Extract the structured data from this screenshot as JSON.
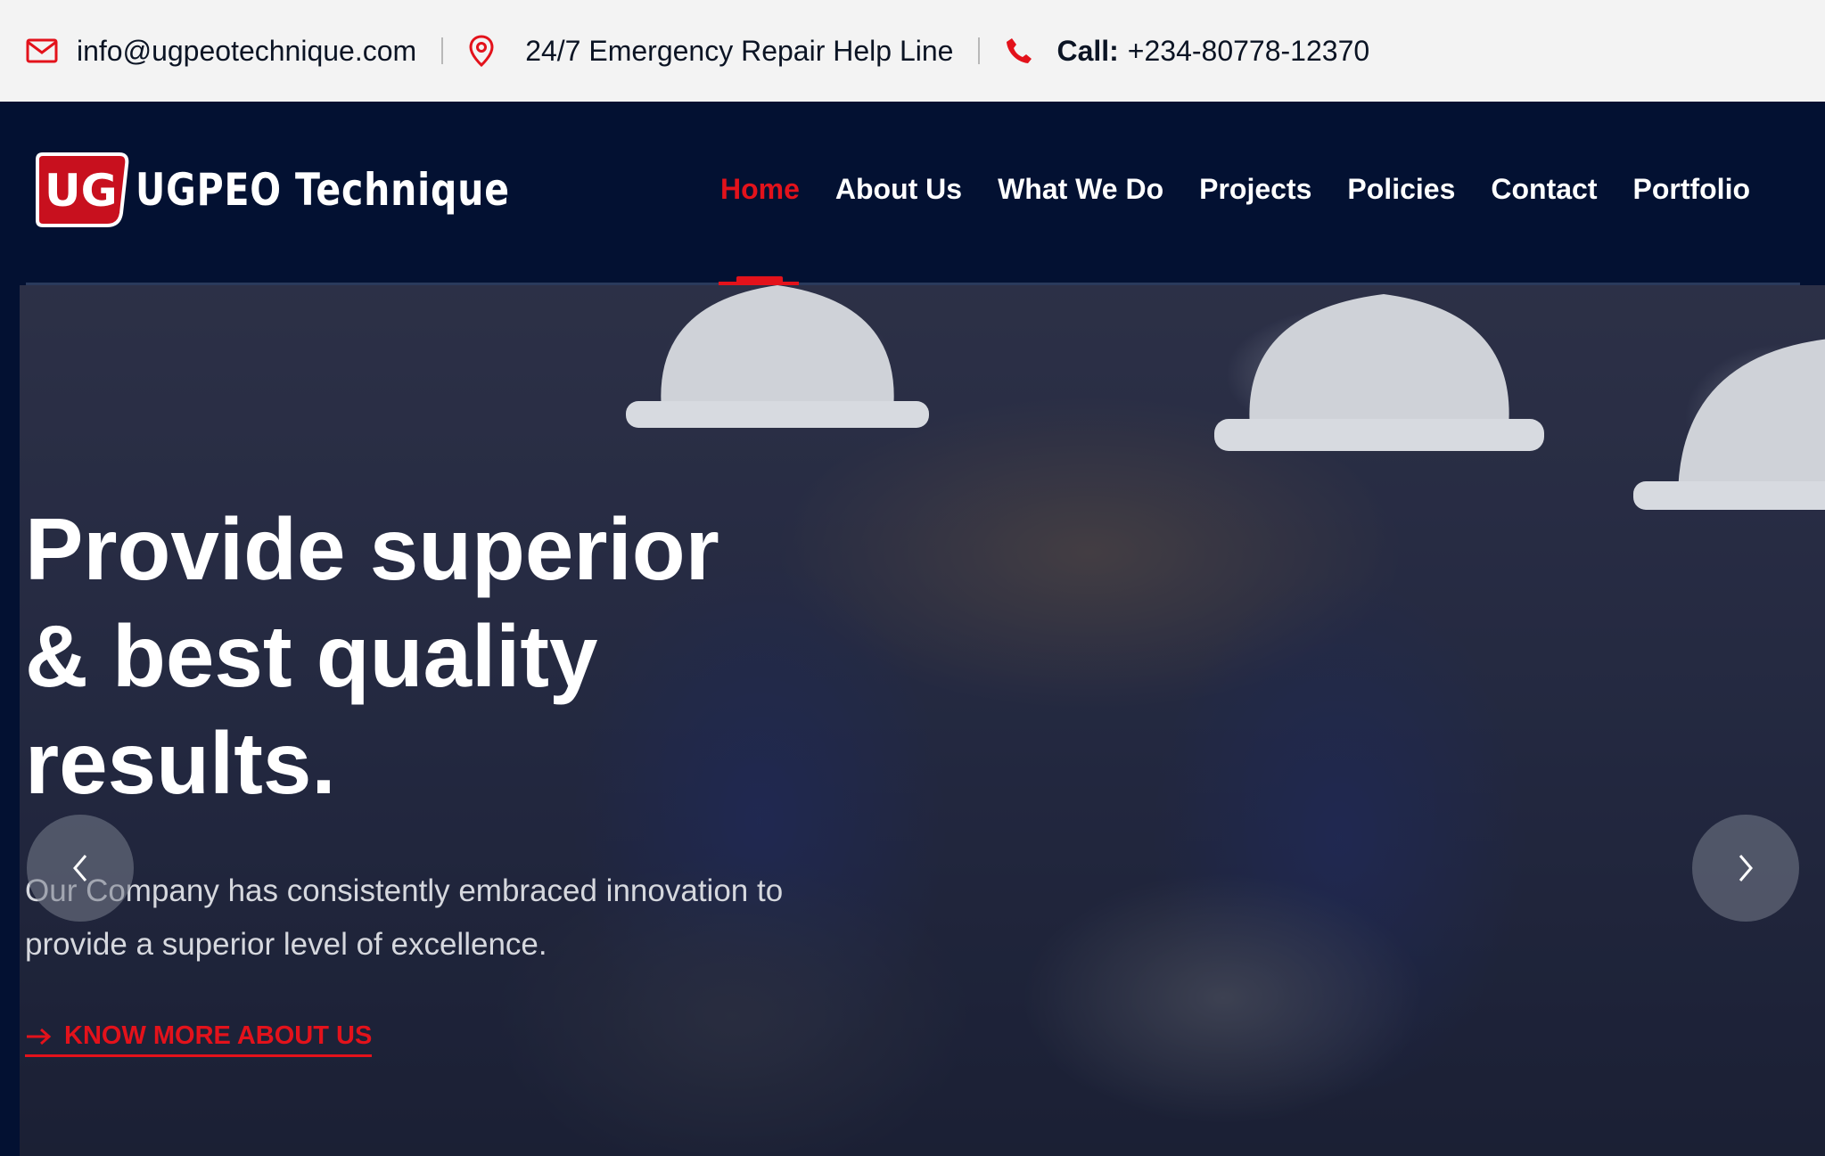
{
  "topbar": {
    "email": "info@ugpeotechnique.com",
    "helpline": "24/7 Emergency Repair Help Line",
    "call_label": "Call:",
    "phone": "+234-80778-12370"
  },
  "logo": {
    "mark": "UG",
    "text": "UGPEO Technique"
  },
  "nav": {
    "items": [
      "Home",
      "About Us",
      "What We Do",
      "Projects",
      "Policies",
      "Contact",
      "Portfolio"
    ],
    "active": "Home"
  },
  "hero": {
    "title_lines": [
      "Provide superior",
      "& best quality",
      "results."
    ],
    "subtitle_lines": [
      "Our Company has consistently embraced innovation to",
      "provide a superior level of excellence."
    ],
    "cta": "KNOW MORE ABOUT US"
  },
  "colors": {
    "brand_red": "#e3121b",
    "navy": "#031132",
    "topbar_bg": "#f3f3f3"
  },
  "icons": [
    "envelope-icon",
    "map-pin-icon",
    "phone-icon",
    "arrow-right-icon",
    "chevron-left-icon",
    "chevron-right-icon"
  ]
}
